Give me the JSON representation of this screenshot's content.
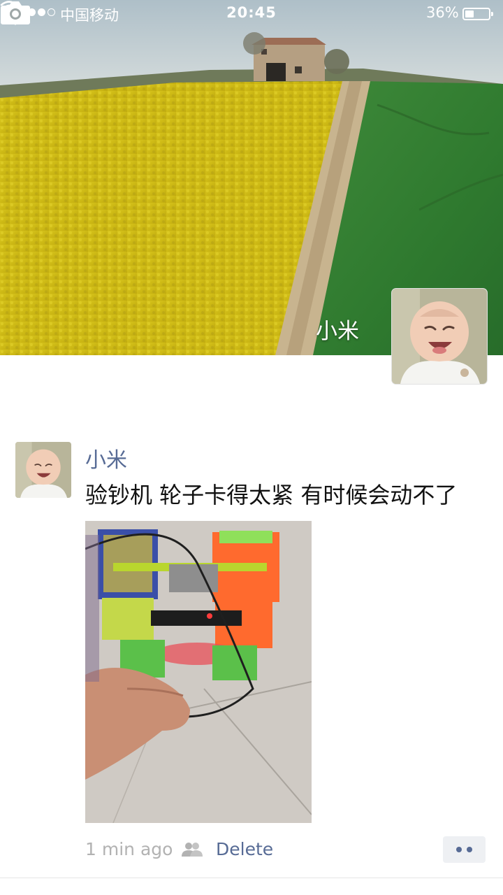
{
  "status_bar": {
    "carrier": "中国移动",
    "time": "20:45",
    "battery_percent": "36%",
    "battery_level": 0.36,
    "signal_strength": 4,
    "signal_max": 5
  },
  "nav": {
    "back_icon": "chevron-left-icon",
    "camera_icon": "camera-icon"
  },
  "profile": {
    "name": "小米"
  },
  "post": {
    "author": "小米",
    "text": "验钞机 轮子卡得太紧 有时候会动不了",
    "time": "1 min ago",
    "visibility_icon": "people-icon",
    "delete_label": "Delete",
    "more_icon": "more-dots-icon"
  },
  "colors": {
    "link": "#576b95",
    "meta_gray": "#b2b2b2",
    "text": "#111111"
  }
}
